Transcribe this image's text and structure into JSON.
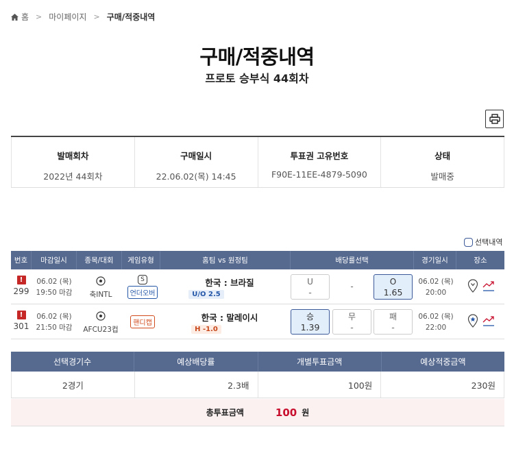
{
  "breadcrumb": {
    "home": "홈",
    "mypage": "마이페이지",
    "current": "구매/적중내역"
  },
  "page": {
    "title": "구매/적중내역",
    "subtitle": "프로토 승부식 44회차"
  },
  "info": [
    {
      "label": "발매회차",
      "value": "2022년 44회차"
    },
    {
      "label": "구매일시",
      "value": "22.06.02(목) 14:45"
    },
    {
      "label": "투표권 고유번호",
      "value": "F90E-11EE-4879-5090"
    },
    {
      "label": "상태",
      "value": "발매중"
    }
  ],
  "filter": {
    "label": "선택내역"
  },
  "game_table": {
    "headers": [
      "번호",
      "마감일시",
      "종목/대회",
      "게임유형",
      "홈팀 vs 원정팀",
      "배당률선택",
      "경기일시",
      "장소"
    ],
    "rows": [
      {
        "no": "299",
        "deadline_date": "06.02 (목)",
        "deadline_time": "19:50 마감",
        "league": "축INTL",
        "game_type": "언더오버",
        "type_badge": "S",
        "teams": "한국 : 브라질",
        "handicap": "U/O 2.5",
        "opt1_label": "U",
        "opt1_odd": "-",
        "opt2": "-",
        "opt3_label": "O",
        "opt3_odd": "1.65",
        "game_date": "06.02 (목)",
        "game_time": "20:00"
      },
      {
        "no": "301",
        "deadline_date": "06.02 (목)",
        "deadline_time": "21:50 마감",
        "league": "AFCU23컵",
        "game_type": "핸디캡",
        "teams": "한국 : 말레이시",
        "handicap": "H -1.0",
        "opt1_label": "승",
        "opt1_odd": "1.39",
        "opt2_label": "무",
        "opt2_odd": "-",
        "opt3_label": "패",
        "opt3_odd": "-",
        "game_date": "06.02 (목)",
        "game_time": "22:00"
      }
    ]
  },
  "summary": {
    "headers": [
      "선택경기수",
      "예상배당률",
      "개별투표금액",
      "예상적중금액"
    ],
    "values": [
      "2경기",
      "2.3배",
      "100원",
      "230원"
    ],
    "total_label": "총투표금액",
    "total_value": "100",
    "total_unit": "원"
  },
  "colors": {
    "header_bg": "#56698f",
    "accent_red": "#c8102e",
    "selected_bg": "#e3eefb"
  }
}
